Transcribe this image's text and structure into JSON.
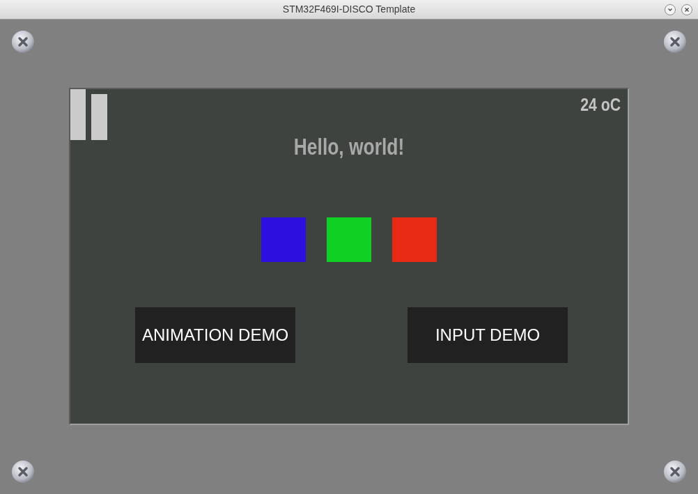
{
  "window": {
    "title": "STM32F469I-DISCO Template"
  },
  "display": {
    "temperature": "24 oC",
    "greeting": "Hello, world!",
    "squares": [
      {
        "color": "#2d0fe0"
      },
      {
        "color": "#10d024"
      },
      {
        "color": "#e82a14"
      }
    ],
    "buttons": [
      "ANIMATION DEMO",
      "INPUT DEMO"
    ]
  }
}
